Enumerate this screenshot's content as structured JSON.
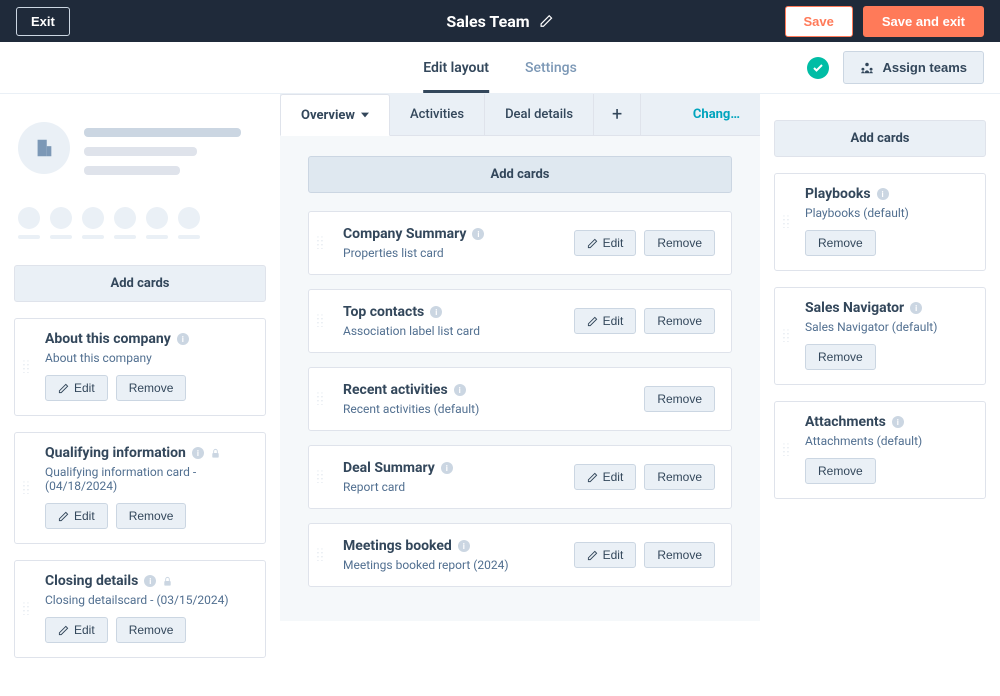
{
  "topbar": {
    "exit": "Exit",
    "title": "Sales Team",
    "save": "Save",
    "save_exit": "Save and exit"
  },
  "subbar": {
    "tabs": {
      "edit_layout": "Edit layout",
      "settings": "Settings"
    },
    "assign_teams": "Assign teams"
  },
  "left": {
    "add_cards": "Add cards",
    "cards": [
      {
        "title": "About this company",
        "sub": "About this company",
        "actions": [
          "Edit",
          "Remove"
        ],
        "info": true,
        "lock": false
      },
      {
        "title": "Qualifying information",
        "sub": "Qualifying information card - (04/18/2024)",
        "actions": [
          "Edit",
          "Remove"
        ],
        "info": true,
        "lock": true
      },
      {
        "title": "Closing details",
        "sub": "Closing detailscard - (03/15/2024)",
        "actions": [
          "Edit",
          "Remove"
        ],
        "info": true,
        "lock": true
      }
    ]
  },
  "middle": {
    "tabs": [
      "Overview",
      "Activities",
      "Deal details"
    ],
    "change": "Chang…",
    "add_cards": "Add cards",
    "cards": [
      {
        "title": "Company Summary",
        "sub": "Properties list card",
        "actions": [
          "Edit",
          "Remove"
        ]
      },
      {
        "title": "Top contacts",
        "sub": "Association label list card",
        "actions": [
          "Edit",
          "Remove"
        ]
      },
      {
        "title": "Recent activities",
        "sub": "Recent activities (default)",
        "actions": [
          "Remove"
        ]
      },
      {
        "title": "Deal Summary",
        "sub": "Report card",
        "actions": [
          "Edit",
          "Remove"
        ]
      },
      {
        "title": "Meetings booked",
        "sub": "Meetings booked report (2024)",
        "actions": [
          "Edit",
          "Remove"
        ]
      }
    ]
  },
  "right": {
    "add_cards": "Add cards",
    "cards": [
      {
        "title": "Playbooks",
        "sub": "Playbooks (default)",
        "actions": [
          "Remove"
        ]
      },
      {
        "title": "Sales Navigator",
        "sub": "Sales Navigator (default)",
        "actions": [
          "Remove"
        ]
      },
      {
        "title": "Attachments",
        "sub": "Attachments (default)",
        "actions": [
          "Remove"
        ]
      }
    ]
  },
  "buttons": {
    "edit": "Edit",
    "remove": "Remove"
  }
}
